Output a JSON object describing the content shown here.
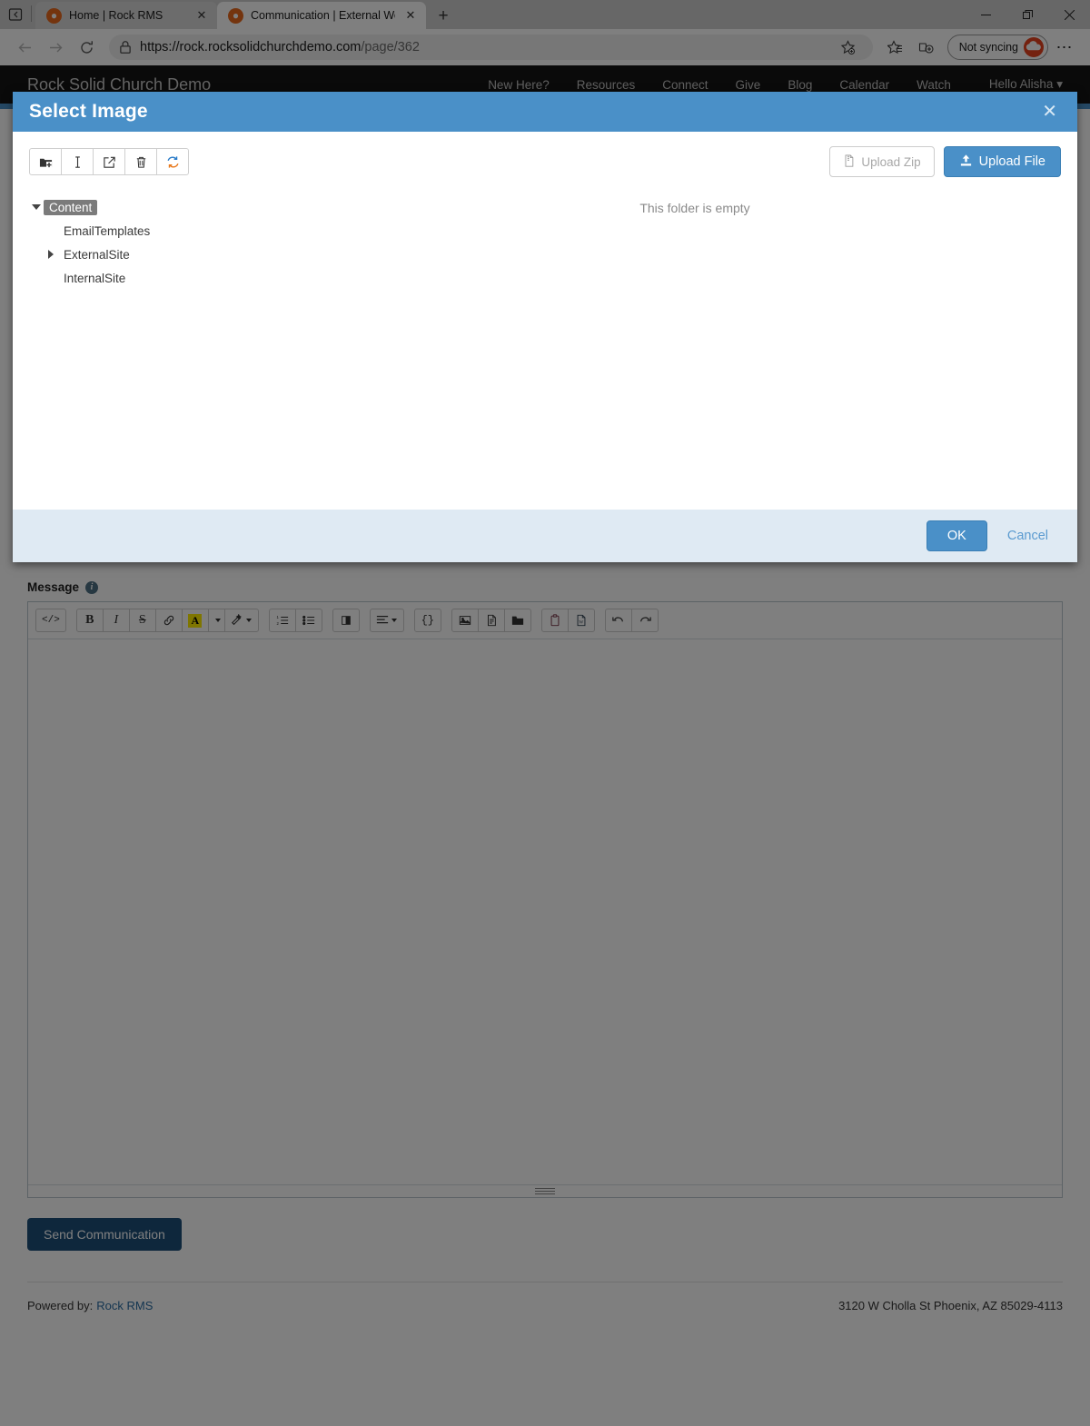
{
  "browser": {
    "tabs": [
      {
        "title": "Home | Rock RMS",
        "favicon": "rock-logo-icon",
        "active": false
      },
      {
        "title": "Communication | External Websi",
        "favicon": "rock-logo-icon",
        "active": true
      }
    ],
    "new_tab_label": "+",
    "tab_list_icon": "tab-list-icon",
    "window_controls": [
      "minimize-icon",
      "restore-icon",
      "close-icon"
    ],
    "toolbar": {
      "back_icon": "back-arrow-icon",
      "forward_icon": "forward-arrow-icon",
      "refresh_icon": "refresh-icon",
      "lock_icon": "lock-icon",
      "url_host": "https://rock.rocksolidchurchdemo.com",
      "url_path": "/page/362",
      "favorite_icon": "add-favorite-icon",
      "collections_icon": "favorites-list-icon",
      "tab_actions_icon": "add-tab-group-icon",
      "sync_label": "Not syncing",
      "profile_icon": "profile-avatar-icon",
      "settings_icon": "more-options-icon"
    }
  },
  "site": {
    "brand": "Rock Solid Church Demo",
    "nav_links": [
      "New Here?",
      "Resources",
      "Connect",
      "Give",
      "Blog",
      "Calendar",
      "Watch"
    ],
    "user_menu": "Hello Alisha",
    "user_menu_caret": "chevron-down-icon"
  },
  "message_field": {
    "label": "Message",
    "info_icon": "info-icon",
    "toolbar_groups": [
      [
        {
          "name": "source-code-button",
          "glyph": "</>"
        }
      ],
      [
        {
          "name": "bold-button",
          "glyph": "B"
        },
        {
          "name": "italic-button",
          "glyph": "I"
        },
        {
          "name": "strikethrough-button",
          "glyph": "S"
        },
        {
          "name": "link-button",
          "glyph": "link-icon"
        },
        {
          "name": "text-color-button",
          "glyph": "A"
        },
        {
          "name": "text-color-dropdown",
          "glyph": "caret"
        },
        {
          "name": "clear-formatting-button",
          "glyph": "magic-wand-icon"
        }
      ],
      [
        {
          "name": "ordered-list-button",
          "glyph": "ordered-list-icon"
        },
        {
          "name": "unordered-list-button",
          "glyph": "unordered-list-icon"
        }
      ],
      [
        {
          "name": "blockquote-button",
          "glyph": "blockquote-icon"
        }
      ],
      [
        {
          "name": "align-button",
          "glyph": "align-icon"
        }
      ],
      [
        {
          "name": "merge-field-button",
          "glyph": "{}"
        }
      ],
      [
        {
          "name": "insert-image-button",
          "glyph": "image-icon"
        },
        {
          "name": "insert-file-button",
          "glyph": "file-icon"
        },
        {
          "name": "browse-folder-button",
          "glyph": "folder-icon"
        }
      ],
      [
        {
          "name": "paste-button",
          "glyph": "clipboard-icon"
        },
        {
          "name": "paste-from-word-button",
          "glyph": "word-doc-icon"
        }
      ],
      [
        {
          "name": "undo-button",
          "glyph": "undo-icon"
        },
        {
          "name": "redo-button",
          "glyph": "redo-icon"
        }
      ]
    ],
    "body_value": "",
    "resize_grip": "resize-grip-icon"
  },
  "send_button_label": "Send Communication",
  "footer": {
    "powered_by_label": "Powered by:",
    "powered_by_link": "Rock RMS",
    "address": "3120 W Cholla St Phoenix, AZ 85029-4113"
  },
  "modal": {
    "title": "Select Image",
    "close_icon": "close-icon",
    "file_toolbar": [
      {
        "name": "new-folder-button",
        "icon": "folder-plus-icon"
      },
      {
        "name": "rename-button",
        "icon": "text-cursor-icon"
      },
      {
        "name": "edit-button",
        "icon": "external-edit-icon"
      },
      {
        "name": "delete-button",
        "icon": "trash-icon"
      },
      {
        "name": "refresh-button",
        "icon": "refresh-icon"
      }
    ],
    "upload_zip_label": "Upload Zip",
    "upload_zip_icon": "zip-file-icon",
    "upload_file_label": "Upload File",
    "upload_file_icon": "upload-icon",
    "tree": {
      "root": {
        "label": "Content",
        "expanded": true,
        "selected": true
      },
      "children": [
        {
          "label": "EmailTemplates",
          "expandable": false
        },
        {
          "label": "ExternalSite",
          "expandable": true
        },
        {
          "label": "InternalSite",
          "expandable": false
        }
      ]
    },
    "empty_message": "This folder is empty",
    "ok_label": "OK",
    "cancel_label": "Cancel"
  },
  "colors": {
    "modal_header": "#4a90c8",
    "modal_footer": "#dfeaf3",
    "primary_button": "#4a90c8",
    "send_button": "#1c4f79",
    "link": "#2b6ca3",
    "site_nav": "#141414",
    "tree_selected": "#7b7b7b"
  }
}
